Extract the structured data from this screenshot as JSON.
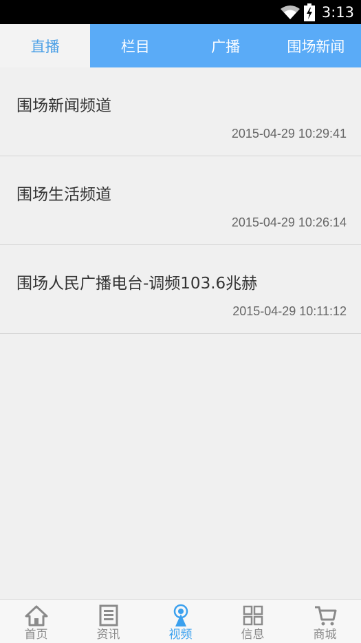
{
  "status_bar": {
    "time": "3:13",
    "icons": [
      "wifi-icon",
      "battery-charging-icon"
    ]
  },
  "tabs": [
    {
      "label": "直播",
      "active": true
    },
    {
      "label": "栏目",
      "active": false
    },
    {
      "label": "广播",
      "active": false
    },
    {
      "label": "围场新闻",
      "active": false
    }
  ],
  "channels": [
    {
      "title": "围场新闻频道",
      "time": "2015-04-29 10:29:41"
    },
    {
      "title": "围场生活频道",
      "time": "2015-04-29 10:26:14"
    },
    {
      "title": "围场人民广播电台-调频103.6兆赫",
      "time": "2015-04-29 10:11:12"
    }
  ],
  "bottom_nav": [
    {
      "label": "首页",
      "icon": "home-icon",
      "active": false
    },
    {
      "label": "资讯",
      "icon": "news-icon",
      "active": false
    },
    {
      "label": "视频",
      "icon": "broadcast-icon",
      "active": true
    },
    {
      "label": "信息",
      "icon": "grid-icon",
      "active": false
    },
    {
      "label": "商城",
      "icon": "cart-icon",
      "active": false
    }
  ],
  "colors": {
    "accent": "#5aabf7",
    "active_text": "#3aa0ee",
    "inactive_text": "#8a8a8a"
  }
}
